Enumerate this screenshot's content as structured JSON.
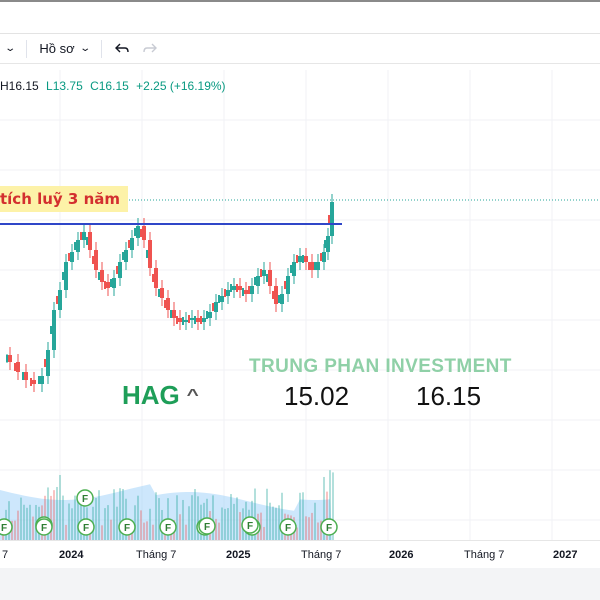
{
  "toolbar": {
    "caret_label": "⌄",
    "profile_label": "Hồ sơ",
    "undo_icon": "undo-arrow",
    "redo_icon": "redo-arrow"
  },
  "ohlc": {
    "h": "H16.15",
    "l": "L13.75",
    "c": "C16.15",
    "change": "+2.25 (+16.19%)"
  },
  "annotation": "tích luỹ 3 năm",
  "watermark": "TRUNG PHAN INVESTMENT",
  "ticker": {
    "symbol": "HAG",
    "caret": "^",
    "price_a": "15.02",
    "price_b": "16.15"
  },
  "time_axis": {
    "labels": [
      {
        "text": "7",
        "bold": false
      },
      {
        "text": "2024",
        "bold": true
      },
      {
        "text": "Tháng 7",
        "bold": false
      },
      {
        "text": "2025",
        "bold": true
      },
      {
        "text": "Tháng 7",
        "bold": false
      },
      {
        "text": "2026",
        "bold": true
      },
      {
        "text": "Tháng 7",
        "bold": false
      },
      {
        "text": "2027",
        "bold": true
      }
    ]
  },
  "colors": {
    "up": "#26a69a",
    "down": "#ef5350",
    "resistance": "#2f46c8",
    "volume_area": "#90caf9",
    "f_marker": "#4caf50"
  },
  "chart_data": {
    "type": "candlestick",
    "resistance_level": "horizontal blue line (approx. 14.0)",
    "last_close": 16.15,
    "earnings_marker_label": "F",
    "earnings_marker_count": 13
  }
}
